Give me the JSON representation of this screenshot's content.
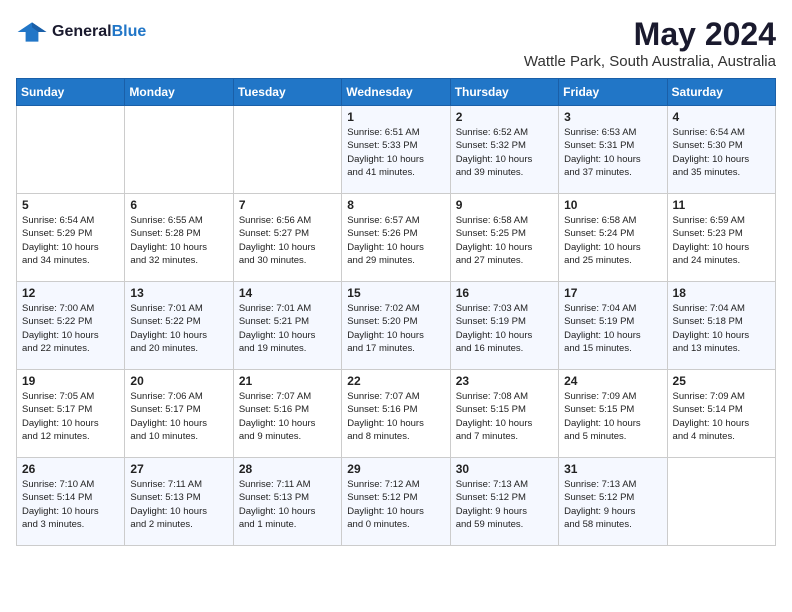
{
  "header": {
    "logo_line1": "General",
    "logo_line2": "Blue",
    "title": "May 2024",
    "subtitle": "Wattle Park, South Australia, Australia"
  },
  "weekdays": [
    "Sunday",
    "Monday",
    "Tuesday",
    "Wednesday",
    "Thursday",
    "Friday",
    "Saturday"
  ],
  "weeks": [
    [
      {
        "day": "",
        "details": ""
      },
      {
        "day": "",
        "details": ""
      },
      {
        "day": "",
        "details": ""
      },
      {
        "day": "1",
        "details": "Sunrise: 6:51 AM\nSunset: 5:33 PM\nDaylight: 10 hours\nand 41 minutes."
      },
      {
        "day": "2",
        "details": "Sunrise: 6:52 AM\nSunset: 5:32 PM\nDaylight: 10 hours\nand 39 minutes."
      },
      {
        "day": "3",
        "details": "Sunrise: 6:53 AM\nSunset: 5:31 PM\nDaylight: 10 hours\nand 37 minutes."
      },
      {
        "day": "4",
        "details": "Sunrise: 6:54 AM\nSunset: 5:30 PM\nDaylight: 10 hours\nand 35 minutes."
      }
    ],
    [
      {
        "day": "5",
        "details": "Sunrise: 6:54 AM\nSunset: 5:29 PM\nDaylight: 10 hours\nand 34 minutes."
      },
      {
        "day": "6",
        "details": "Sunrise: 6:55 AM\nSunset: 5:28 PM\nDaylight: 10 hours\nand 32 minutes."
      },
      {
        "day": "7",
        "details": "Sunrise: 6:56 AM\nSunset: 5:27 PM\nDaylight: 10 hours\nand 30 minutes."
      },
      {
        "day": "8",
        "details": "Sunrise: 6:57 AM\nSunset: 5:26 PM\nDaylight: 10 hours\nand 29 minutes."
      },
      {
        "day": "9",
        "details": "Sunrise: 6:58 AM\nSunset: 5:25 PM\nDaylight: 10 hours\nand 27 minutes."
      },
      {
        "day": "10",
        "details": "Sunrise: 6:58 AM\nSunset: 5:24 PM\nDaylight: 10 hours\nand 25 minutes."
      },
      {
        "day": "11",
        "details": "Sunrise: 6:59 AM\nSunset: 5:23 PM\nDaylight: 10 hours\nand 24 minutes."
      }
    ],
    [
      {
        "day": "12",
        "details": "Sunrise: 7:00 AM\nSunset: 5:22 PM\nDaylight: 10 hours\nand 22 minutes."
      },
      {
        "day": "13",
        "details": "Sunrise: 7:01 AM\nSunset: 5:22 PM\nDaylight: 10 hours\nand 20 minutes."
      },
      {
        "day": "14",
        "details": "Sunrise: 7:01 AM\nSunset: 5:21 PM\nDaylight: 10 hours\nand 19 minutes."
      },
      {
        "day": "15",
        "details": "Sunrise: 7:02 AM\nSunset: 5:20 PM\nDaylight: 10 hours\nand 17 minutes."
      },
      {
        "day": "16",
        "details": "Sunrise: 7:03 AM\nSunset: 5:19 PM\nDaylight: 10 hours\nand 16 minutes."
      },
      {
        "day": "17",
        "details": "Sunrise: 7:04 AM\nSunset: 5:19 PM\nDaylight: 10 hours\nand 15 minutes."
      },
      {
        "day": "18",
        "details": "Sunrise: 7:04 AM\nSunset: 5:18 PM\nDaylight: 10 hours\nand 13 minutes."
      }
    ],
    [
      {
        "day": "19",
        "details": "Sunrise: 7:05 AM\nSunset: 5:17 PM\nDaylight: 10 hours\nand 12 minutes."
      },
      {
        "day": "20",
        "details": "Sunrise: 7:06 AM\nSunset: 5:17 PM\nDaylight: 10 hours\nand 10 minutes."
      },
      {
        "day": "21",
        "details": "Sunrise: 7:07 AM\nSunset: 5:16 PM\nDaylight: 10 hours\nand 9 minutes."
      },
      {
        "day": "22",
        "details": "Sunrise: 7:07 AM\nSunset: 5:16 PM\nDaylight: 10 hours\nand 8 minutes."
      },
      {
        "day": "23",
        "details": "Sunrise: 7:08 AM\nSunset: 5:15 PM\nDaylight: 10 hours\nand 7 minutes."
      },
      {
        "day": "24",
        "details": "Sunrise: 7:09 AM\nSunset: 5:15 PM\nDaylight: 10 hours\nand 5 minutes."
      },
      {
        "day": "25",
        "details": "Sunrise: 7:09 AM\nSunset: 5:14 PM\nDaylight: 10 hours\nand 4 minutes."
      }
    ],
    [
      {
        "day": "26",
        "details": "Sunrise: 7:10 AM\nSunset: 5:14 PM\nDaylight: 10 hours\nand 3 minutes."
      },
      {
        "day": "27",
        "details": "Sunrise: 7:11 AM\nSunset: 5:13 PM\nDaylight: 10 hours\nand 2 minutes."
      },
      {
        "day": "28",
        "details": "Sunrise: 7:11 AM\nSunset: 5:13 PM\nDaylight: 10 hours\nand 1 minute."
      },
      {
        "day": "29",
        "details": "Sunrise: 7:12 AM\nSunset: 5:12 PM\nDaylight: 10 hours\nand 0 minutes."
      },
      {
        "day": "30",
        "details": "Sunrise: 7:13 AM\nSunset: 5:12 PM\nDaylight: 9 hours\nand 59 minutes."
      },
      {
        "day": "31",
        "details": "Sunrise: 7:13 AM\nSunset: 5:12 PM\nDaylight: 9 hours\nand 58 minutes."
      },
      {
        "day": "",
        "details": ""
      }
    ]
  ]
}
